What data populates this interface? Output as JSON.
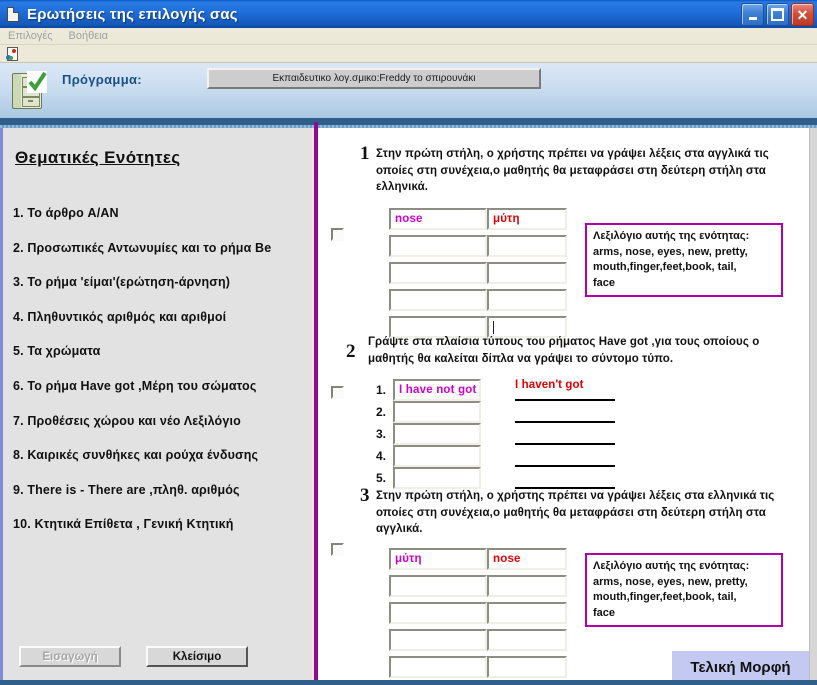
{
  "window": {
    "title": "Ερωτήσεις της επιλογής σας",
    "icon": "document-icon",
    "buttons": {
      "minimize": "_",
      "maximize": "□",
      "close": "✕"
    }
  },
  "menu": {
    "items": [
      "Επιλογές",
      "Βοήθεια"
    ]
  },
  "toolbar": {
    "icon": "new-document-icon"
  },
  "program": {
    "icon": "cabinet-check-icon",
    "label": "Πρόγραμμα:",
    "value": "Εκπαιδευτικο λογ.σμικο:Freddy το σπιρουνάκι"
  },
  "sidebar": {
    "title": "Θεματικές Ενότητες",
    "items": [
      "1. Το άρθρο A/AN",
      "2. Προσωπικές Αντωνυμίες και το ρήμα Be",
      "3. Το ρήμα 'είμαι'(ερώτηση-άρνηση)",
      "4. Πληθυντικός αριθμός και αριθμοί",
      "5. Τα χρώματα",
      "6. Το ρήμα Have got ,Μέρη του σώματος",
      "7. Προθέσεις χώρου και νέο Λεξιλόγιο",
      "8. Καιρικές συνθήκες και ρούχα ένδυσης",
      "9. There is - There are ,πληθ. αριθμός",
      "10. Κτητικά Επίθετα , Γενική Κτητική"
    ],
    "buttons": {
      "insert": "Εισαγωγή",
      "close": "Κλείσιμο"
    }
  },
  "sections": [
    {
      "number": "1",
      "instruction": "Στην πρώτη στήλη,  ο χρήστης πρέπει να γράψει λέξεις στα αγγλικά τις οποίες στη συνέχεια,ο μαθητής θα μεταφράσει στη δεύτερη στήλη στα ελληνικά.",
      "left_column": [
        "nose",
        "",
        "",
        "",
        ""
      ],
      "right_column": [
        "μύτη",
        "",
        "",
        "",
        ""
      ],
      "left_color": "#cc00cc",
      "right_color": "#e00000",
      "vocab_title": "Λεξιλόγιο αυτής της ενότητας:",
      "vocab_lines": [
        "arms,  nose,  eyes,  new,  pretty,",
        "mouth,finger,feet,book, tail,",
        "face"
      ]
    },
    {
      "number": "2",
      "instruction": "Γράψτε στα πλαίσια τύπους του ρήματος Have got ,για τους οποίους ο μαθητής θα καλείται δίπλα να γράψει το σύντομο τύπο.",
      "row_numbers": [
        "1.",
        "2.",
        "3.",
        "4.",
        "5."
      ],
      "left_column": [
        "I have not got",
        "",
        "",
        "",
        ""
      ],
      "right_answer": "I haven't got",
      "left_color": "#cc00cc",
      "right_color": "#e00000"
    },
    {
      "number": "3",
      "instruction": "Στην πρώτη στήλη, ο χρήστης πρέπει να γράψει λέξεις στα ελληνικά τις οποίες στη συνέχεια,ο μαθητής θα μεταφράσει στη δεύτερη στήλη στα αγγλικά.",
      "left_column": [
        "μύτη",
        "",
        "",
        "",
        ""
      ],
      "right_column": [
        "nose",
        "",
        "",
        "",
        ""
      ],
      "left_color": "#cc00cc",
      "right_color": "#e00000",
      "vocab_title": "Λεξιλόγιο αυτής της ενότητας:",
      "vocab_lines": [
        "arms,  nose,  eyes,  new, pretty,",
        "mouth,finger,feet,book, tail,",
        "face"
      ]
    }
  ],
  "final_badge": "Τελική Μορφή",
  "colors": {
    "title_bar": "#1f6fdd",
    "divider_purple": "#8e0a8e",
    "vocab_border": "#b000b0",
    "magenta_text": "#cc00cc",
    "red_text": "#e00000",
    "badge_bg": "#c3c9f0"
  }
}
